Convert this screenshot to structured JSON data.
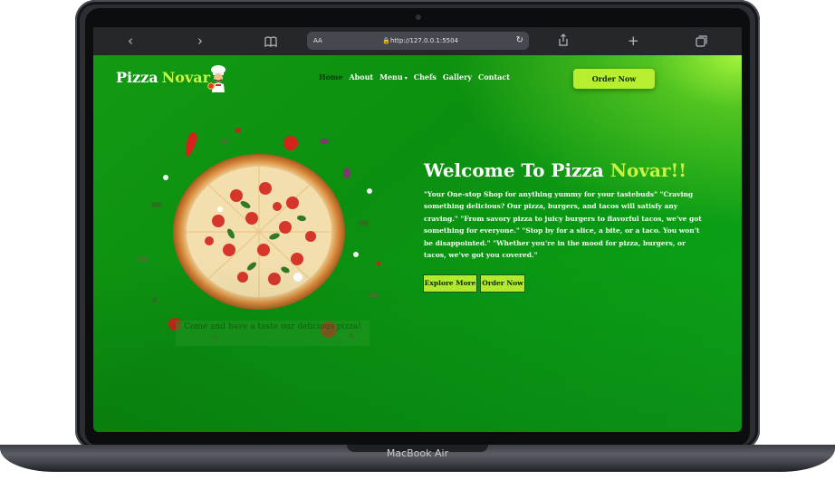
{
  "device": {
    "label": "MacBook Air"
  },
  "browser": {
    "text_size": "AA",
    "url": "http://127.0.0.1:5504"
  },
  "site": {
    "logo": {
      "name": "Pizza",
      "accent": "Novar"
    },
    "nav": [
      "Home",
      "About",
      "Menu",
      "Chefs",
      "Gallery",
      "Contact"
    ],
    "menu_caret": "▾",
    "order_button": "Order Now",
    "hero": {
      "title": "Welcome To Pizza",
      "title_accent": "Novar!!",
      "description": "\"Your One-stop Shop for anything yummy for your tastebuds\" \"Craving something delicious? Our pizza, burgers, and tacos will satisfy any craving.\" \"From savory pizza to juicy burgers to flavorful tacos, we've got something for everyone.\" \"Stop by for a slice, a bite, or a taco. You won't be disappointed.\" \"Whether you're in the mood for pizza, burgers, or tacos, we've got you covered.\"",
      "caption": "Come and have a taste our delicious pizza!",
      "explore_button": "Explore More",
      "order_button": "Order Now"
    }
  },
  "colors": {
    "accent": "#c8f442",
    "button": "#b7ee2f",
    "background": "#0b8f10"
  }
}
